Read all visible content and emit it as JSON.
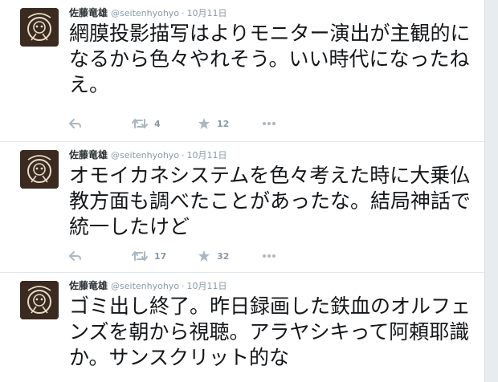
{
  "tweets": [
    {
      "name": "佐藤竜雄",
      "handle": "@seitenhyohyo",
      "date": "10月11日",
      "text": "網膜投影描写はよりモニター演出が主観的になるから色々やれそう。いい時代になったねえ。",
      "retweets": "4",
      "favorites": "12"
    },
    {
      "name": "佐藤竜雄",
      "handle": "@seitenhyohyo",
      "date": "10月11日",
      "text": "オモイカネシステムを色々考えた時に大乗仏教方面も調べたことがあったな。結局神話で統一したけど",
      "retweets": "17",
      "favorites": "32"
    },
    {
      "name": "佐藤竜雄",
      "handle": "@seitenhyohyo",
      "date": "10月11日",
      "text": "ゴミ出し終了。昨日録画した鉄血のオルフェンズを朝から視聴。アラヤシキって阿頼耶識か。サンスクリット的な"
    }
  ],
  "dot_separator": "·",
  "icons": {
    "reply": "reply-icon",
    "retweet": "retweet-icon",
    "favorite": "star-icon",
    "more": "more-icon"
  },
  "colors": {
    "action_icon": "#aab8c2",
    "meta_text": "#8899a6",
    "divider": "#e1e8ed"
  }
}
